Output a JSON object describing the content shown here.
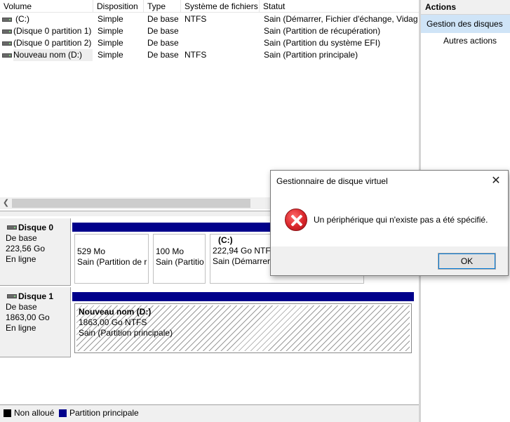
{
  "volume_list": {
    "columns": [
      "Volume",
      "Disposition",
      "Type",
      "Système de fichiers",
      "Statut"
    ],
    "rows": [
      {
        "volume": "(C:)",
        "layout": "Simple",
        "type": "De base",
        "fs": "NTFS",
        "status": "Sain (Démarrer, Fichier d'échange, Vidage"
      },
      {
        "volume": "(Disque 0 partition 1)",
        "layout": "Simple",
        "type": "De base",
        "fs": "",
        "status": "Sain (Partition de récupération)"
      },
      {
        "volume": "(Disque 0 partition 2)",
        "layout": "Simple",
        "type": "De base",
        "fs": "",
        "status": "Sain (Partition du système EFI)"
      },
      {
        "volume": "Nouveau nom (D:)",
        "layout": "Simple",
        "type": "De base",
        "fs": "NTFS",
        "status": "Sain (Partition principale)"
      }
    ]
  },
  "disks": [
    {
      "name": "Disque 0",
      "type": "De base",
      "size": "223,56 Go",
      "state": "En ligne",
      "partitions": [
        {
          "label": "",
          "size": "529 Mo",
          "status": "Sain (Partition de r"
        },
        {
          "label": "",
          "size": "100 Mo",
          "status": "Sain (Partitio"
        },
        {
          "label": "(C:)",
          "size": "222,94 Go NTFS",
          "status": "Sain (Démarrer,"
        }
      ]
    },
    {
      "name": "Disque 1",
      "type": "De base",
      "size": "1863,00 Go",
      "state": "En ligne",
      "partitions": [
        {
          "label": "Nouveau nom  (D:)",
          "size": "1863,00 Go NTFS",
          "status": "Sain (Partition principale)"
        }
      ]
    }
  ],
  "legend": [
    {
      "label": "Non alloué",
      "color": "#000000"
    },
    {
      "label": "Partition principale",
      "color": "#00008b"
    }
  ],
  "actions": {
    "title": "Actions",
    "selected": "Gestion des disques",
    "more": "Autres actions"
  },
  "dialog": {
    "title": "Gestionnaire de disque virtuel",
    "message": "Un périphérique qui n'existe pas a été spécifié.",
    "ok": "OK",
    "close_icon": "close-icon",
    "status_icon": "error-icon"
  },
  "colors": {
    "primary_partition": "#00008b",
    "selection": "#cfe4f7",
    "error_red": "#d9262b"
  }
}
